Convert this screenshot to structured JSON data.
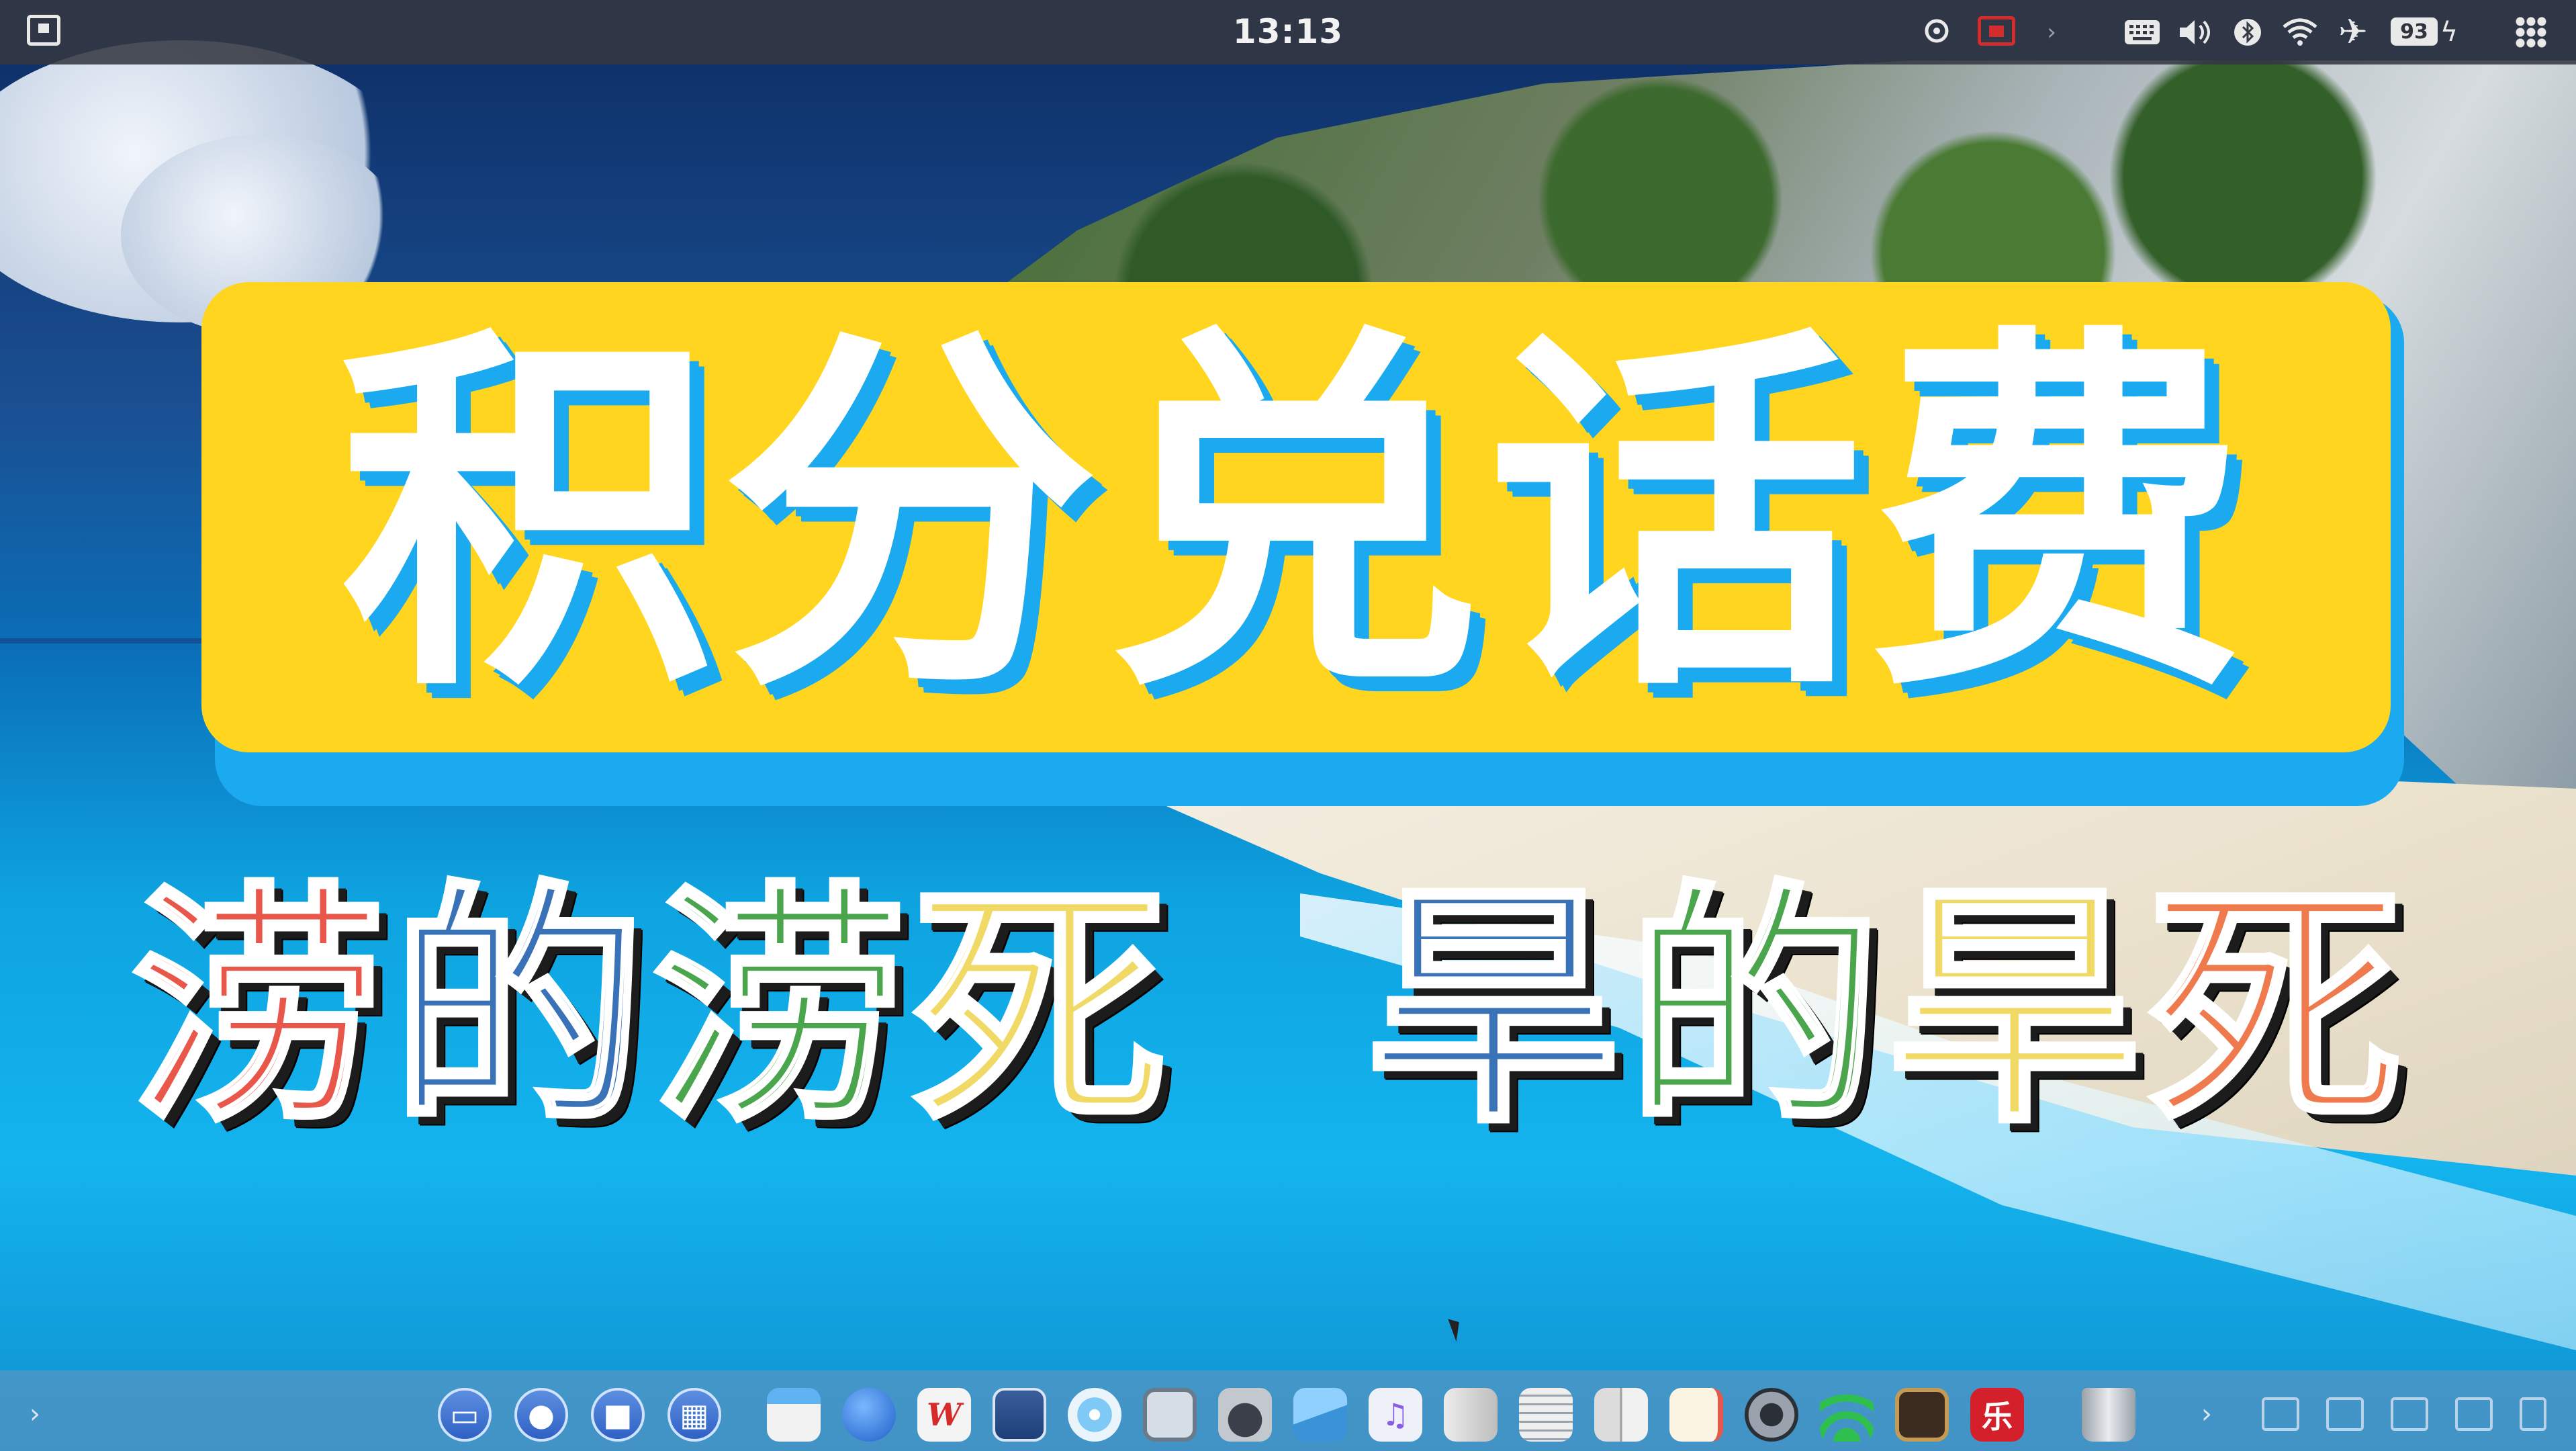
{
  "topbar": {
    "clock": "13:13",
    "battery_level": "93",
    "icons": [
      "screen-display-icon",
      "search-icon",
      "screen-record-icon",
      "chevron-right-icon",
      "keyboard-icon",
      "volume-icon",
      "bluetooth-icon",
      "wifi-icon",
      "airplane-mode-icon",
      "battery-icon",
      "charging-icon",
      "app-grid-icon"
    ]
  },
  "overlay": {
    "headline": "积分兑话费",
    "slogan_left": [
      "涝",
      "的",
      "涝",
      "死"
    ],
    "slogan_right": [
      "旱",
      "的",
      "旱",
      "死"
    ],
    "colors": {
      "headline_text": "#ffffff",
      "headline_border_yellow": "#ffd51f",
      "headline_border_blue": "#1ba9ef",
      "slogan_left": [
        "#e8574a",
        "#3a72b8",
        "#4aa54c",
        "#f0d965"
      ],
      "slogan_right": [
        "#3a72b8",
        "#4aa54c",
        "#f0d965",
        "#ef7a4e"
      ]
    }
  },
  "dock": {
    "left_arrow": "›",
    "right_arrow": "›",
    "apps": [
      {
        "name": "multitask-view-icon",
        "glyph": ""
      },
      {
        "name": "launcher-icon",
        "glyph": ""
      },
      {
        "name": "workspace-icon",
        "glyph": ""
      },
      {
        "name": "app-grid-icon",
        "glyph": ""
      },
      {
        "name": "file-manager-icon",
        "glyph": ""
      },
      {
        "name": "browser-icon",
        "glyph": ""
      },
      {
        "name": "wps-office-icon",
        "glyph": "W"
      },
      {
        "name": "notes-icon",
        "glyph": ""
      },
      {
        "name": "music-disc-icon",
        "glyph": ""
      },
      {
        "name": "remote-desktop-icon",
        "glyph": ""
      },
      {
        "name": "app-store-icon",
        "glyph": ""
      },
      {
        "name": "image-viewer-icon",
        "glyph": ""
      },
      {
        "name": "music-player-icon",
        "glyph": "♫"
      },
      {
        "name": "documents-icon",
        "glyph": ""
      },
      {
        "name": "text-editor-icon",
        "glyph": ""
      },
      {
        "name": "book-reader-icon",
        "glyph": ""
      },
      {
        "name": "memo-icon",
        "glyph": ""
      },
      {
        "name": "system-monitor-icon",
        "glyph": ""
      },
      {
        "name": "network-icon",
        "glyph": ""
      },
      {
        "name": "terminal-icon",
        "glyph": ""
      },
      {
        "name": "dictionary-icon",
        "glyph": "乐"
      },
      {
        "name": "trash-icon",
        "glyph": ""
      }
    ],
    "tray": [
      "picture-icon",
      "window-icon",
      "clipboard-icon",
      "notification-icon",
      "show-desktop-icon"
    ]
  }
}
